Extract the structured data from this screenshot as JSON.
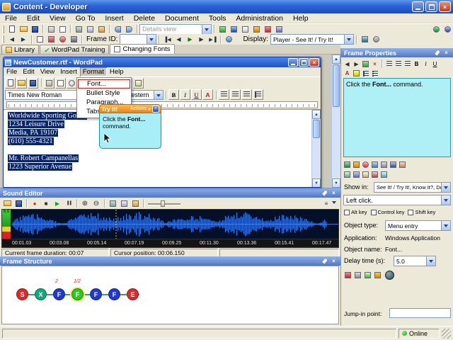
{
  "icons": {
    "close": "×",
    "play": "▶",
    "record": "●",
    "stop": "■",
    "pause": "▐▐",
    "first": "▐◀",
    "prev": "◀",
    "next": "▶",
    "last": "▶▐",
    "bold": "B",
    "italic": "I",
    "underline": "U",
    "color": "A",
    "zoom_in": "⊕",
    "zoom_out": "⊖",
    "menu": "≡",
    "check": "✓",
    "up_arrow": "▲",
    "down_arrow": "▼"
  },
  "window": {
    "title": "Content - Developer"
  },
  "menu_bar": {
    "items": [
      "File",
      "Edit",
      "View",
      "Go To",
      "Insert",
      "Delete",
      "Document",
      "Tools",
      "Administration",
      "Help"
    ]
  },
  "toolbar": {
    "details_view": "Details view",
    "frame_id_label": "Frame ID:",
    "display_label": "Display:",
    "display_value": "Player - See It! / Try It!"
  },
  "tabs": {
    "labels": [
      "Library",
      "WordPad Training",
      "Changing Fonts"
    ]
  },
  "wordpad": {
    "title": "NewCustomer.rtf - WordPad",
    "menu_items": [
      "File",
      "Edit",
      "View",
      "Insert",
      "Format",
      "Help"
    ],
    "format_menu": [
      "Font...",
      "Bullet Style",
      "Paragraph...",
      "Tabs..."
    ],
    "font_name": "Times New Roman",
    "font_script": "Western",
    "document": {
      "block1": [
        "Worldwide Sporting Goods",
        "1234 Leisure Drive",
        "Media, PA 19107",
        "(610) 555-4321"
      ],
      "block2": [
        "Mr. Robert Campanellas",
        "1223 Superior Avenue"
      ]
    }
  },
  "callout": {
    "title": "Try It!",
    "actions_label": "Actions",
    "text_prefix": "Click the ",
    "text_bold": "Font...",
    "text_suffix": " command."
  },
  "sound_editor": {
    "title": "Sound Editor",
    "meter_label": "6.0",
    "timestamps": [
      "00:01.03",
      "00:03.08",
      "00:05.14",
      "00:07.19",
      "00:09.25",
      "00:11.30",
      "00:13.36",
      "00:15.41",
      "00:17.47"
    ],
    "duration_status": "Current frame duration: 00:07",
    "cursor_status": "Cursor position: 00:06.150"
  },
  "frame_structure": {
    "title": "Frame Structure",
    "nodes": [
      {
        "label": "S",
        "color": "#e02828",
        "annotation": ""
      },
      {
        "label": "X",
        "color": "#12a87c",
        "annotation": ""
      },
      {
        "label": "F",
        "color": "#2038d8",
        "annotation": "2"
      },
      {
        "label": "F",
        "color": "#28c828",
        "annotation": "1/2"
      },
      {
        "label": "F",
        "color": "#2038d8",
        "annotation": ""
      },
      {
        "label": "F",
        "color": "#2038d8",
        "annotation": ""
      },
      {
        "label": "E",
        "color": "#e02828",
        "annotation": ""
      }
    ]
  },
  "properties": {
    "title": "Frame Properties",
    "hint_prefix": "Click the ",
    "hint_bold": "Font...",
    "hint_suffix": " command.",
    "show_in_label": "Show in:",
    "show_in_value": "See It! / Try It!, Know It?, Do It!",
    "click_type_value": "Left click.",
    "checkboxes": [
      "Alt key",
      "Control key",
      "Shift key"
    ],
    "object_type_label": "Object type:",
    "object_type_value": "Menu entry",
    "application_label": "Application:",
    "application_value": "Windows Application",
    "object_name_label": "Object name:",
    "object_name_value": "Font...",
    "delay_label": "Delay time (s):",
    "delay_value": "5.0",
    "jump_in_label": "Jump-in point:"
  },
  "status_bar": {
    "online": "Online"
  }
}
